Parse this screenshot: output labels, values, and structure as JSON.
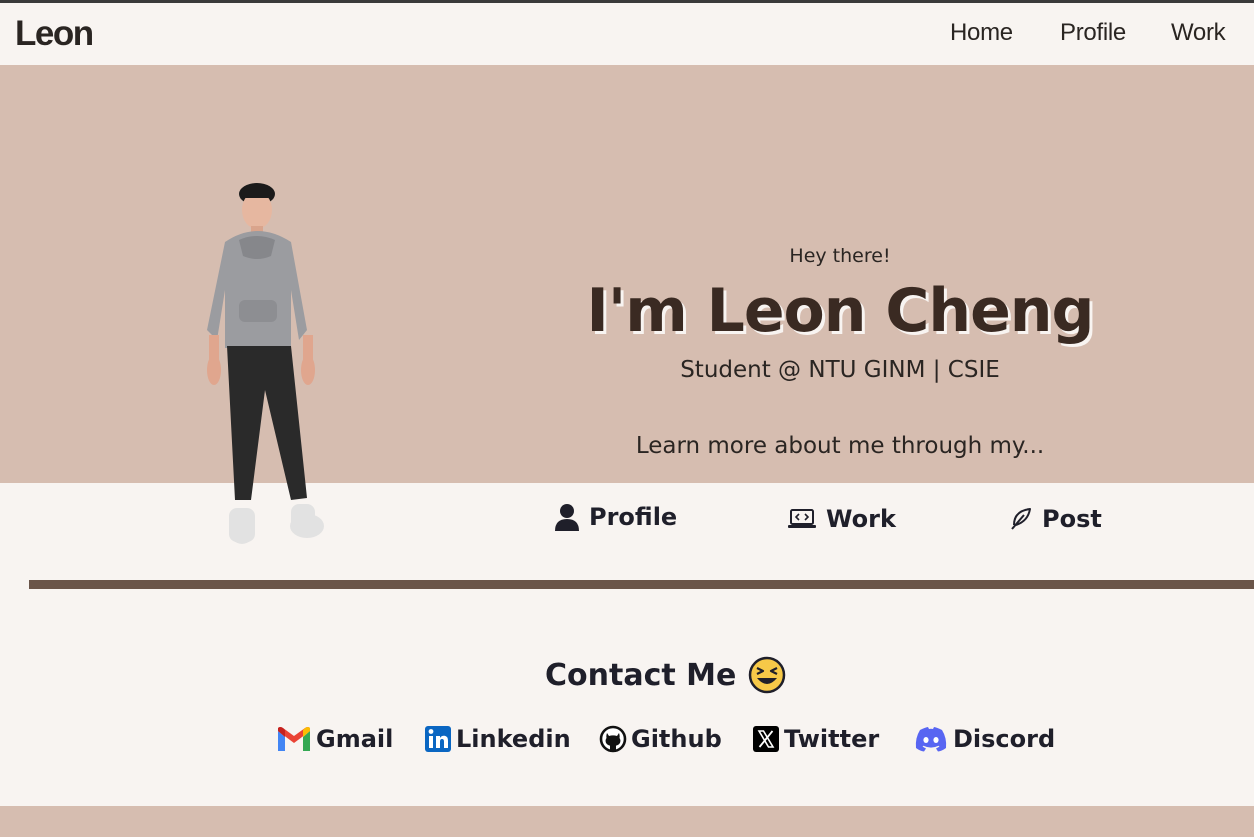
{
  "nav": {
    "logo": "Leon",
    "links": [
      "Home",
      "Profile",
      "Work"
    ]
  },
  "hero": {
    "greeting": "Hey there!",
    "name": "I'm Leon Cheng",
    "subtitle": "Student @ NTU GINM | CSIE",
    "prompt": "Learn more about me through my..."
  },
  "sections": [
    {
      "label": "Profile",
      "icon": "user-icon"
    },
    {
      "label": "Work",
      "icon": "laptop-code-icon"
    },
    {
      "label": "Post",
      "icon": "feather-icon"
    }
  ],
  "contact": {
    "title": "Contact Me",
    "emoji": "laughing-face-icon",
    "links": [
      {
        "label": "Gmail",
        "icon": "gmail-icon"
      },
      {
        "label": "Linkedin",
        "icon": "linkedin-icon"
      },
      {
        "label": "Github",
        "icon": "github-icon"
      },
      {
        "label": "Twitter",
        "icon": "x-twitter-icon"
      },
      {
        "label": "Discord",
        "icon": "discord-icon"
      }
    ]
  },
  "colors": {
    "hero_bg": "#d6bdb0",
    "page_bg": "#f8f4f1",
    "divider": "#6a5549",
    "text_dark": "#2a2522"
  }
}
